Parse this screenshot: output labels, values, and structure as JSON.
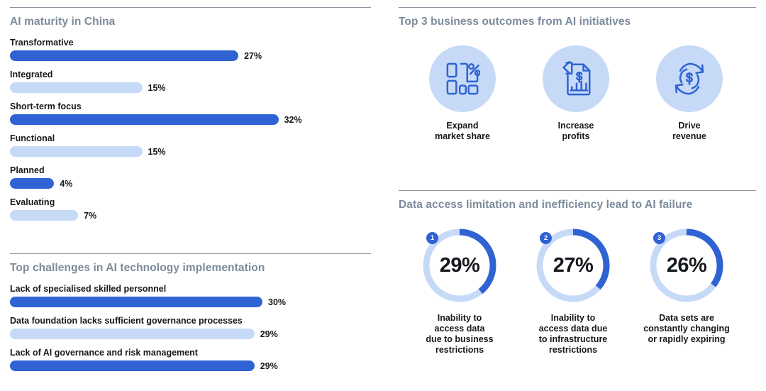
{
  "colors": {
    "bar_dark": "#2f62d3",
    "bar_light": "#c6daf8",
    "header_text": "#7c8b9b",
    "body_text": "#15181c",
    "rule": "#8b949e",
    "donut_track": "#c6daf8",
    "donut_arc": "#2f62d3",
    "icon_circle_bg": "#c6daf8",
    "icon_stroke": "#2f62d3"
  },
  "chart_data": [
    {
      "type": "bar",
      "title": "AI maturity in China",
      "orientation": "horizontal",
      "xlabel": "",
      "ylabel": "",
      "unit": "%",
      "categories": [
        "Transformative",
        "Integrated",
        "Short-term focus",
        "Functional",
        "Planned",
        "Evaluating"
      ],
      "values": [
        27,
        15,
        32,
        15,
        4,
        7
      ],
      "value_labels": [
        "27%",
        "15%",
        "32%",
        "15%",
        "4%",
        "7%"
      ],
      "bar_colors": [
        "dark",
        "light",
        "dark",
        "light",
        "dark",
        "light"
      ],
      "grid": false,
      "legend": "none"
    },
    {
      "type": "bar",
      "title": "Top challenges in AI technology implementation",
      "orientation": "horizontal",
      "xlabel": "",
      "ylabel": "",
      "unit": "%",
      "categories": [
        "Lack of specialised skilled personnel",
        "Data foundation lacks sufficient governance processes",
        "Lack of AI governance and risk management"
      ],
      "values": [
        30,
        29,
        29
      ],
      "value_labels": [
        "30%",
        "29%",
        "29%"
      ],
      "bar_colors": [
        "dark",
        "light",
        "dark"
      ],
      "grid": false,
      "legend": "none"
    },
    {
      "type": "pie",
      "subtype": "donut",
      "title": "Data access limitation and inefficiency lead to AI failure",
      "unit": "%",
      "categories": [
        "Inability to access data due to business restrictions",
        "Inability to access data due to infrastructure restrictions",
        "Data sets are constantly changing or rapidly expiring"
      ],
      "values": [
        29,
        27,
        26
      ],
      "value_labels": [
        "29%",
        "27%",
        "26%"
      ],
      "rank_badges": [
        "1",
        "2",
        "3"
      ],
      "legend": "below"
    }
  ],
  "maturity": {
    "title": "AI maturity in China",
    "rows": [
      {
        "label": "Transformative",
        "value": "27%",
        "pct": 27,
        "tone": "dark"
      },
      {
        "label": "Integrated",
        "value": "15%",
        "pct": 15,
        "tone": "light"
      },
      {
        "label": "Short-term focus",
        "value": "32%",
        "pct": 32,
        "tone": "dark"
      },
      {
        "label": "Functional",
        "value": "15%",
        "pct": 15,
        "tone": "light"
      },
      {
        "label": "Planned",
        "value": "4%",
        "pct": 4,
        "tone": "dark"
      },
      {
        "label": "Evaluating",
        "value": "7%",
        "pct": 7,
        "tone": "light"
      }
    ]
  },
  "challenges": {
    "title": "Top challenges in AI technology implementation",
    "rows": [
      {
        "label": "Lack of specialised skilled personnel",
        "value": "30%",
        "pct": 30,
        "tone": "dark"
      },
      {
        "label": "Data foundation lacks sufficient governance processes",
        "value": "29%",
        "pct": 29,
        "tone": "light"
      },
      {
        "label": "Lack of AI governance and risk management",
        "value": "29%",
        "pct": 29,
        "tone": "dark"
      }
    ]
  },
  "outcomes": {
    "title": "Top 3 business outcomes from AI initiatives",
    "items": [
      {
        "icon": "market-share-icon",
        "line1": "Expand",
        "line2": "market share"
      },
      {
        "icon": "profit-document-icon",
        "line1": "Increase",
        "line2": "profits"
      },
      {
        "icon": "revenue-cycle-icon",
        "line1": "Drive",
        "line2": "revenue"
      }
    ]
  },
  "data_access": {
    "title": "Data access limitation and inefficiency lead to AI failure",
    "items": [
      {
        "badge": "1",
        "value": "29%",
        "pct": 29,
        "lines": [
          "Inability to",
          "access data",
          "due to business",
          "restrictions"
        ]
      },
      {
        "badge": "2",
        "value": "27%",
        "pct": 27,
        "lines": [
          "Inability to",
          "access data due",
          "to infrastructure",
          "restrictions"
        ]
      },
      {
        "badge": "3",
        "value": "26%",
        "pct": 26,
        "lines": [
          "Data sets are",
          "constantly changing",
          "or rapidly expiring"
        ]
      }
    ]
  }
}
